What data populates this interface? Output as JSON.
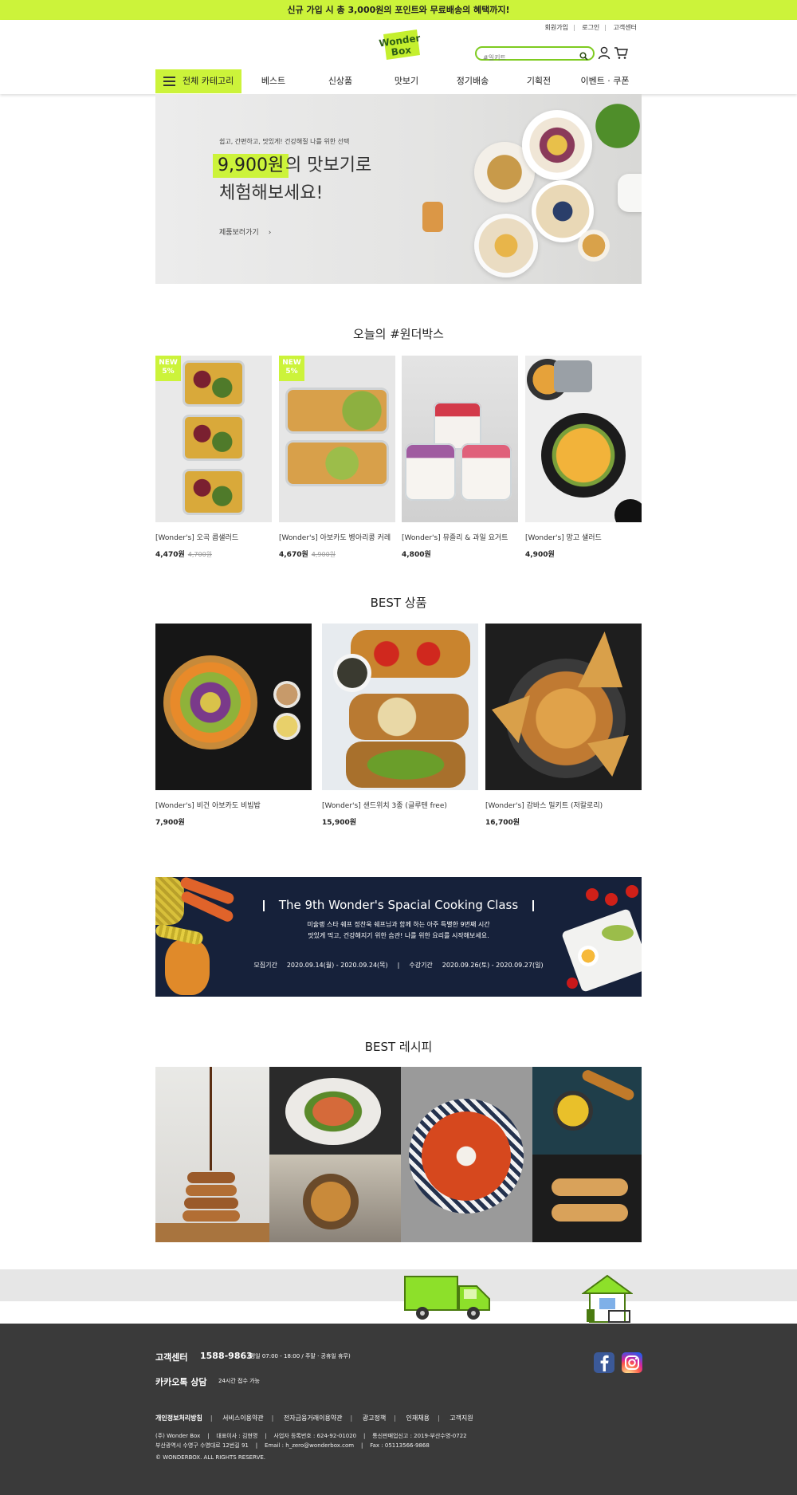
{
  "promo": {
    "text": "신규 가입 시 총 3,000원의 포인트와 무료배송의 혜택까지!"
  },
  "util": {
    "join": "회원가입",
    "login": "로그인",
    "cs": "고객센터",
    "sep": "|"
  },
  "logo": {
    "line1": "Wonder",
    "line2": "Box"
  },
  "search": {
    "placeholder": "#일키트"
  },
  "nav": {
    "all_category": "전체 카테고리",
    "items": [
      "베스트",
      "신상품",
      "맛보기",
      "정기배송",
      "기획전",
      "이벤트 · 쿠폰"
    ]
  },
  "hero": {
    "sub": "쉽고, 간편하고, 맛있게! 건강해질 나를 위한 선택",
    "price": "9,900원",
    "line1": "의 맛보기로",
    "line2": "체험해보세요!",
    "cta": "제품보러가기",
    "cta_arrow": "›"
  },
  "today": {
    "title": "오늘의 #원더박스",
    "badge": {
      "top": "NEW",
      "bottom": "5%"
    },
    "items": [
      {
        "name": "[Wonder's] 오곡 콥샐러드",
        "price": "4,470원",
        "old": "4,700원"
      },
      {
        "name": "[Wonder's] 아보카도 병아리콩 커레",
        "price": "4,670원",
        "old": "4,900원"
      },
      {
        "name": "[Wonder's] 뮤즐리 & 과일 요거트",
        "price": "4,800원",
        "old": ""
      },
      {
        "name": "[Wonder's] 망고 샐러드",
        "price": "4,900원",
        "old": ""
      }
    ]
  },
  "best": {
    "title": "BEST 상품",
    "items": [
      {
        "name": "[Wonder's] 비건 아보카도 비빔밥",
        "price": "7,900원"
      },
      {
        "name": "[Wonder's] 샌드위치 3종 (글루텐 free)",
        "price": "15,900원"
      },
      {
        "name": "[Wonder's] 감바스 밀키트 (저칼로리)",
        "price": "16,700원"
      }
    ]
  },
  "cooking": {
    "title": "The 9th Wonder's Spacial Cooking Class",
    "desc1": "미슐랭 스타 쉐프 정찬욱 쉐프님과 함께 하는 아주 특별한 9번째 시간",
    "desc2": "맛있게 먹고, 건강해지기 위한 습관! 나를 위한 요리를 시작해보세요.",
    "recruit_label": "모집기간",
    "recruit": "2020.09.14(월) - 2020.09.24(목)",
    "sep": "|",
    "class_label": "수강기간",
    "class": "2020.09.26(토) - 2020.09.27(일)"
  },
  "recipes": {
    "title": "BEST 레시피"
  },
  "footer": {
    "cs_label": "고객센터",
    "tel": "1588-9863",
    "hours": "(평일 07:00 - 18:00 / 주말 · 공휴일 휴무)",
    "kakao_label": "카카오톡 상담",
    "kakao_hours": "24시간 접수 가능",
    "links": [
      "개인정보처리방침",
      "서비스이용약관",
      "전자금융거래이용약관",
      "광고정책",
      "인재채용",
      "고객지원"
    ],
    "info1": "(주) Wonder Box    |    대표이사 : 김현명    |    사업자 등록번호 : 624-92-01020    |    통신판매업신고 : 2019-부산수영-0722",
    "info2": "부산광역시 수영구 수영대로 12번길 91    |    Email : h_zero@wonderbox.com    |    Fax : 05113566-9868",
    "copyright": "© WONDERBOX. ALL RIGHTS RESERVE."
  },
  "colors": {
    "accent": "#ccf33a",
    "search_border": "#7ecb20",
    "footer_bg": "#3a3a3a",
    "cooking_bg": "#16213a"
  }
}
